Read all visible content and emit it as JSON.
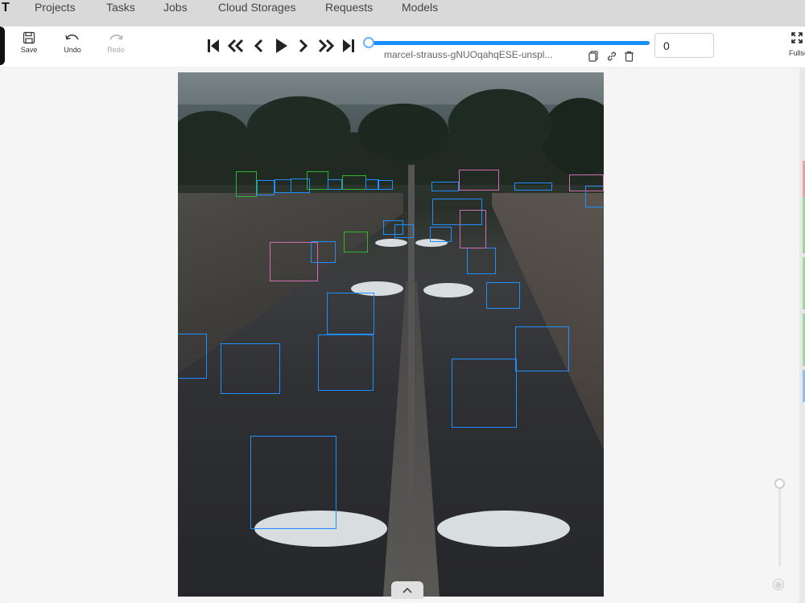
{
  "app": {
    "logo_text": "T"
  },
  "nav": {
    "items": [
      {
        "label": "Projects"
      },
      {
        "label": "Tasks"
      },
      {
        "label": "Jobs"
      },
      {
        "label": "Cloud Storages"
      },
      {
        "label": "Requests"
      },
      {
        "label": "Models"
      }
    ]
  },
  "toolbar": {
    "save_label": "Save",
    "undo_label": "Undo",
    "redo_label": "Redo",
    "fullscreen_label": "Fullscreen"
  },
  "player": {
    "buttons": [
      "first-frame-icon",
      "back-many-icon",
      "previous-icon",
      "play-icon",
      "next-icon",
      "forward-many-icon",
      "last-frame-icon"
    ],
    "frame_position": 0
  },
  "frame": {
    "filename": "marcel-strauss-gNUOqahqESE-unspl...",
    "number": "0"
  },
  "annotations": {
    "box_colors": {
      "blue": "#1f8fff",
      "green": "#2fb52f",
      "pink": "#d070b0"
    }
  },
  "zoom": {
    "level": 0
  }
}
